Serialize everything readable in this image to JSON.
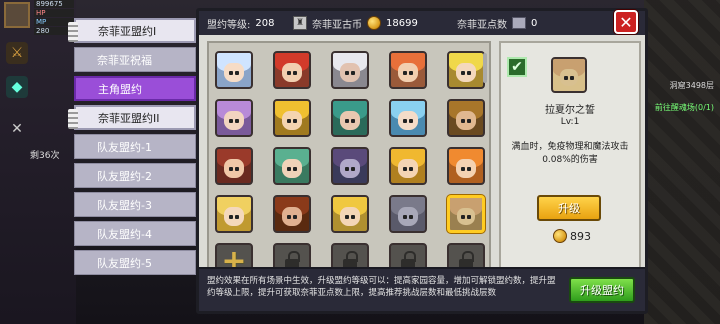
{
  "hud": {
    "gold": "899675",
    "hp_label": "HP",
    "mp_label": "MP",
    "level": "280",
    "kill_text": "剩36次"
  },
  "right_scene": {
    "area_label": "洞窟3498层",
    "quest_label": "前往醒魂场(0/1)"
  },
  "tabs": [
    {
      "label": "奈菲亚盟约I",
      "state": "header"
    },
    {
      "label": "奈菲亚祝福",
      "state": "normal"
    },
    {
      "label": "主角盟约",
      "state": "active"
    },
    {
      "label": "奈菲亚盟约II",
      "state": "header"
    },
    {
      "label": "队友盟约-1",
      "state": "normal"
    },
    {
      "label": "队友盟约-2",
      "state": "normal"
    },
    {
      "label": "队友盟约-3",
      "state": "normal"
    },
    {
      "label": "队友盟约-4",
      "state": "normal"
    },
    {
      "label": "队友盟约-5",
      "state": "normal"
    }
  ],
  "topbar": {
    "alliance_level_label": "盟约等级:",
    "alliance_level_value": "208",
    "ancient_coin_label": "奈菲亚古币",
    "ancient_coin_value": "18699",
    "points_label": "奈菲亚点数",
    "points_value": "0"
  },
  "colors": {
    "active_tab": "#9a4ed8",
    "upgrade_button": "#e8a210",
    "alliance_upgrade_button": "#2f9d1c",
    "close_button": "#cc2222"
  },
  "grid": {
    "characters": [
      {
        "hair": "#cfe4ff",
        "skin": "#f6dcc6",
        "bg": "#8aa4c8"
      },
      {
        "hair": "#d23a2a",
        "skin": "#f2cfb0",
        "bg": "#8a3a2a"
      },
      {
        "hair": "#e8e8ee",
        "skin": "#e2c2b0",
        "bg": "#8a8890"
      },
      {
        "hair": "#e8703a",
        "skin": "#f2cfb0",
        "bg": "#9a5a3a"
      },
      {
        "hair": "#f0d84a",
        "skin": "#f4d8bc",
        "bg": "#a88a30"
      },
      {
        "hair": "#b88ad8",
        "skin": "#f2d4c0",
        "bg": "#7a5a9a"
      },
      {
        "hair": "#f0c030",
        "skin": "#f4d4b0",
        "bg": "#a07a20"
      },
      {
        "hair": "#3a9a8a",
        "skin": "#e8c8b0",
        "bg": "#2a6a5a"
      },
      {
        "hair": "#8ad0f0",
        "skin": "#f4dcc8",
        "bg": "#4a8ab0"
      },
      {
        "hair": "#a8762a",
        "skin": "#e0b890",
        "bg": "#6a4a20"
      },
      {
        "hair": "#9a3a2a",
        "skin": "#f0c8a8",
        "bg": "#6a2a20"
      },
      {
        "hair": "#5ab090",
        "skin": "#f0d2b8",
        "bg": "#3a7a60"
      },
      {
        "hair": "#5a4a7a",
        "skin": "#b0a8c8",
        "bg": "#3a3a5a"
      },
      {
        "hair": "#f0b830",
        "skin": "#f4d4b4",
        "bg": "#b08020"
      },
      {
        "hair": "#f08a30",
        "skin": "#f4d2b2",
        "bg": "#b06020"
      },
      {
        "hair": "#f0d060",
        "skin": "#f4d8bc",
        "bg": "#c09a30"
      },
      {
        "hair": "#8a3a1a",
        "skin": "#e0b090",
        "bg": "#5a2a10"
      },
      {
        "hair": "#f0c840",
        "skin": "#f4d6b6",
        "bg": "#b09030"
      },
      {
        "hair": "#7a7a8a",
        "skin": "#a8a8b8",
        "bg": "#5a5a6a"
      },
      {
        "hair": "#c8a070",
        "skin": "#d8c090",
        "bg": "#9a8050"
      }
    ],
    "selected_index": 19,
    "locked_count": 4
  },
  "detail": {
    "name": "拉夏尔之誓",
    "level": "Lv:1",
    "description": "满血时，免疫物理和魔法攻击0.08%的伤害",
    "upgrade_label": "升级",
    "cost": "893"
  },
  "footer": {
    "info": "盟约效果在所有场景中生效，升级盟约等级可以：提高家园容量，增加可解锁盟约数，提升盟约等级上限，提升可获取奈菲亚点数上限，提高推荐挑战层数和最低挑战层数",
    "alliance_upgrade_label": "升级盟约"
  }
}
